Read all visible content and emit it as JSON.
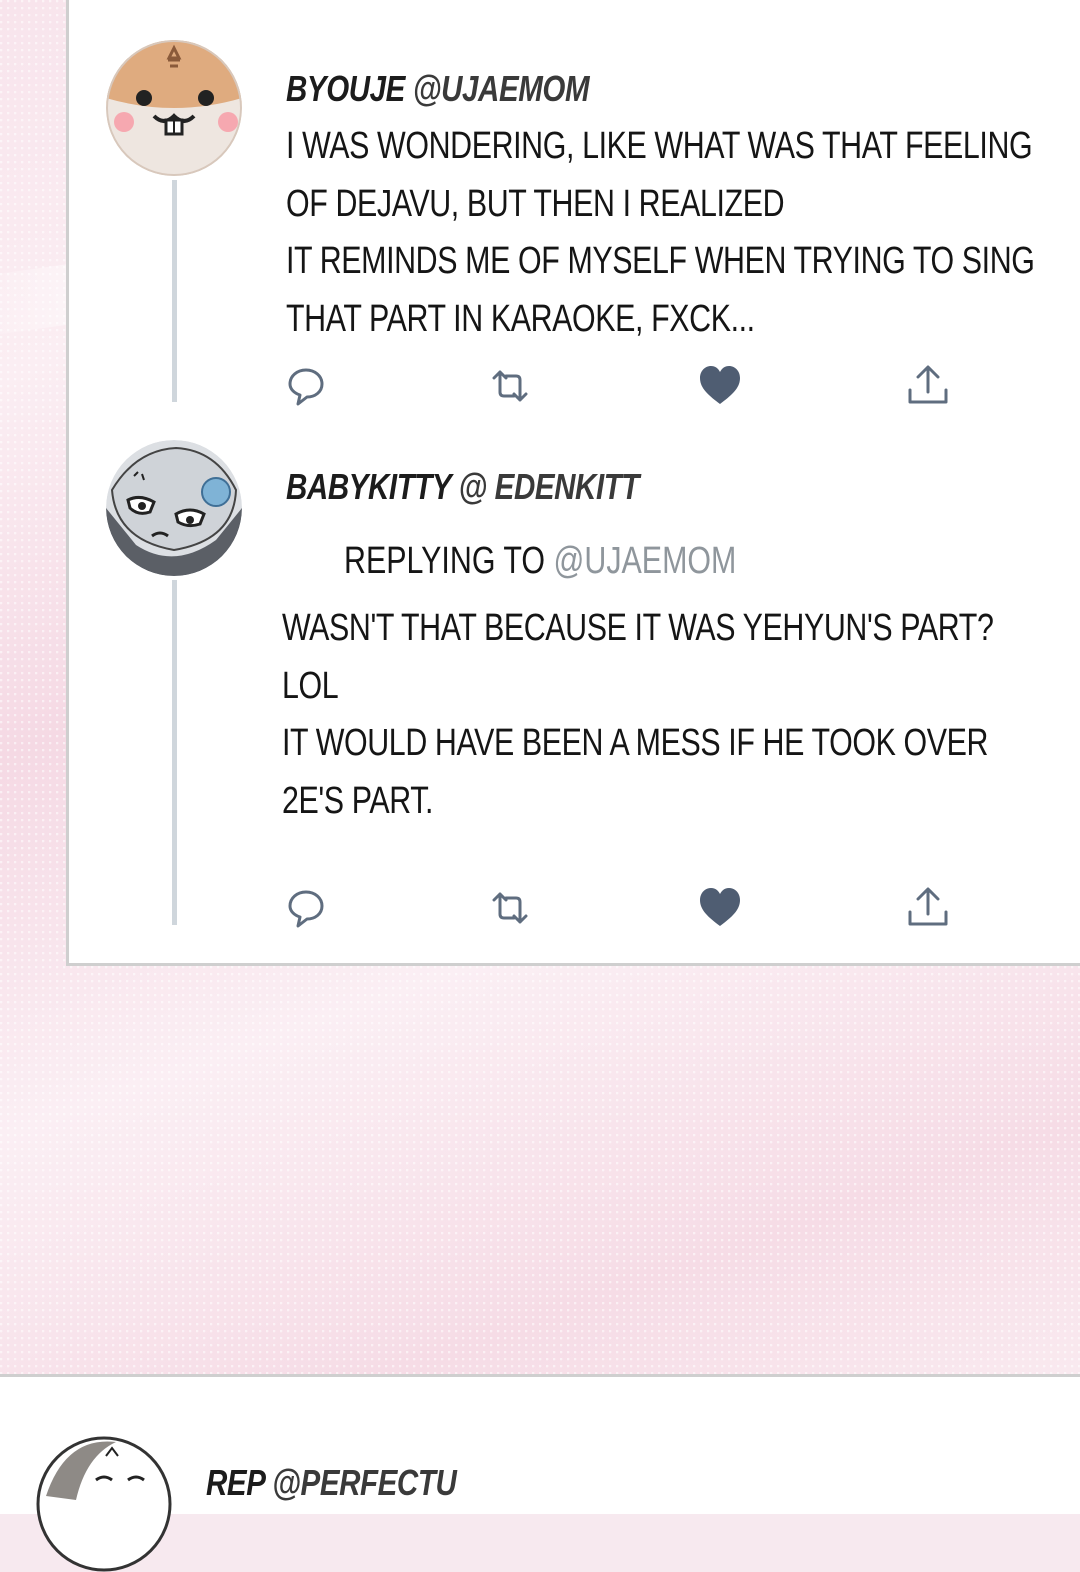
{
  "tweets": [
    {
      "name": "BYOUJE",
      "handle": "@UJAEMOM",
      "text": "I WAS WONDERING, LIKE WHAT  WAS THAT FEELING\nOF DEJAVU, BUT THEN I REALIZED\nIT REMINDS ME OF MYSELF WHEN TRYING TO SING\nTHAT PART IN KARAOKE, FXCK...",
      "avatar": "hamster-avatar"
    },
    {
      "name": "BABYKITTY",
      "handle": "@ EDENKITT",
      "reply_prefix": "REPLYING TO",
      "reply_handle": "@UJAEMOM",
      "text": "WASN'T THAT BECAUSE IT WAS YEHYUN'S PART?\nLOL\nIT WOULD HAVE BEEN A MESS IF HE TOOK OVER\n2E'S PART.",
      "avatar": "cat-avatar"
    },
    {
      "name": "REP",
      "handle": "@PERFECTU",
      "avatar": "face-avatar"
    }
  ],
  "actions": {
    "reply_icon": "comment-icon",
    "retweet_icon": "retweet-icon",
    "like_icon": "heart-icon",
    "share_icon": "share-icon"
  },
  "colors": {
    "icon": "#5f6d7f",
    "heart": "#4f5d72",
    "thread_line": "#cfd6dc",
    "reply_handle": "#8f969c"
  }
}
